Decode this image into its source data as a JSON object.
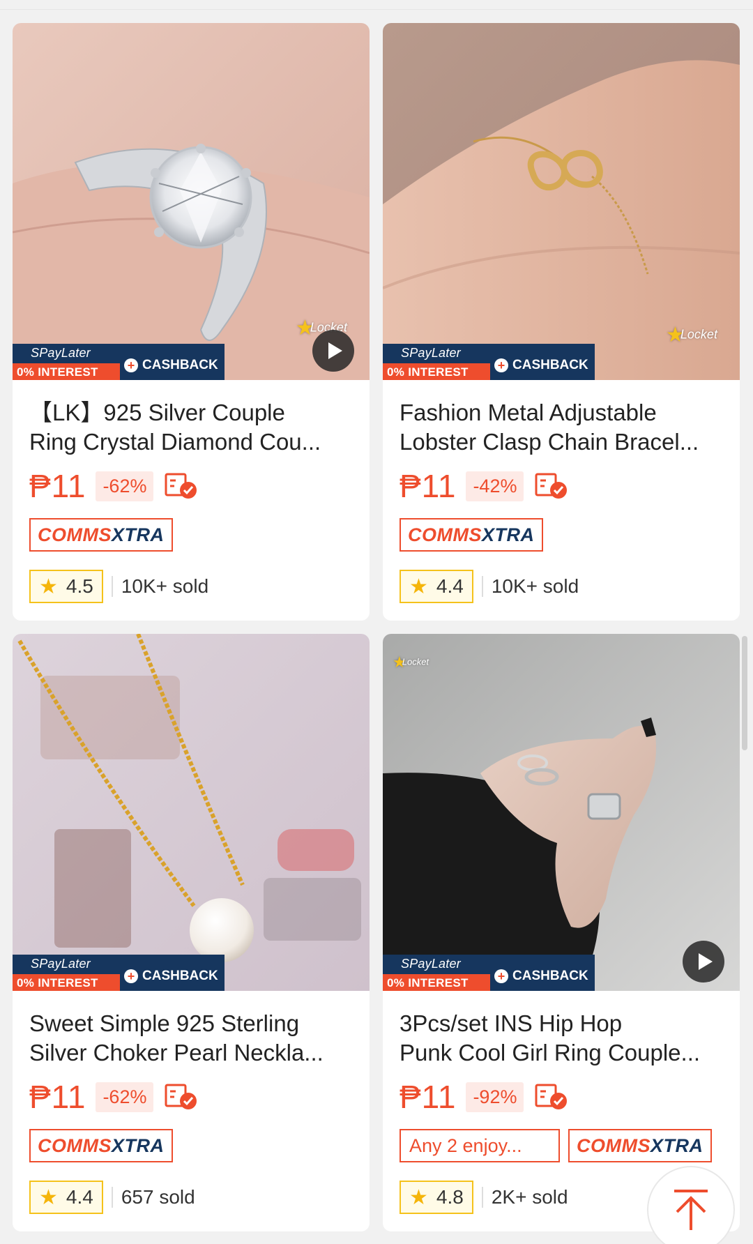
{
  "promo": {
    "spaylater": "SPayLater",
    "interest": "0% INTEREST",
    "cashback": "CASHBACK",
    "brand": "Locket"
  },
  "products": [
    {
      "title_line1": "【LK】925 Silver Couple",
      "title_line2": "Ring Crystal Diamond Cou...",
      "price": "₱11",
      "discount": "-62%",
      "rating": "4.5",
      "sold": "10K+ sold",
      "has_video": true
    },
    {
      "title_line1": "Fashion Metal Adjustable",
      "title_line2": "Lobster Clasp Chain Bracel...",
      "price": "₱11",
      "discount": "-42%",
      "rating": "4.4",
      "sold": "10K+ sold",
      "has_video": false
    },
    {
      "title_line1": "Sweet Simple 925 Sterling",
      "title_line2": "Silver Choker Pearl Neckla...",
      "price": "₱11",
      "discount": "-62%",
      "rating": "4.4",
      "sold": "657 sold",
      "has_video": false
    },
    {
      "title_line1": "3Pcs/set INS Hip Hop",
      "title_line2": "Punk Cool Girl Ring Couple...",
      "price": "₱11",
      "discount": "-92%",
      "extra_tag": "Any 2 enjoy...",
      "rating": "4.8",
      "sold": "2K+ sold",
      "has_video": true
    }
  ],
  "tags": {
    "comms_part1": "COMMS",
    "comms_part2": "XTRA"
  },
  "icons": {
    "play": "play-icon",
    "cod": "cod-check-icon",
    "star": "star-icon",
    "back_to_top": "arrow-up-icon"
  },
  "colors": {
    "accent": "#ee4d2d",
    "navy": "#16365e",
    "star": "#f5b50a"
  }
}
